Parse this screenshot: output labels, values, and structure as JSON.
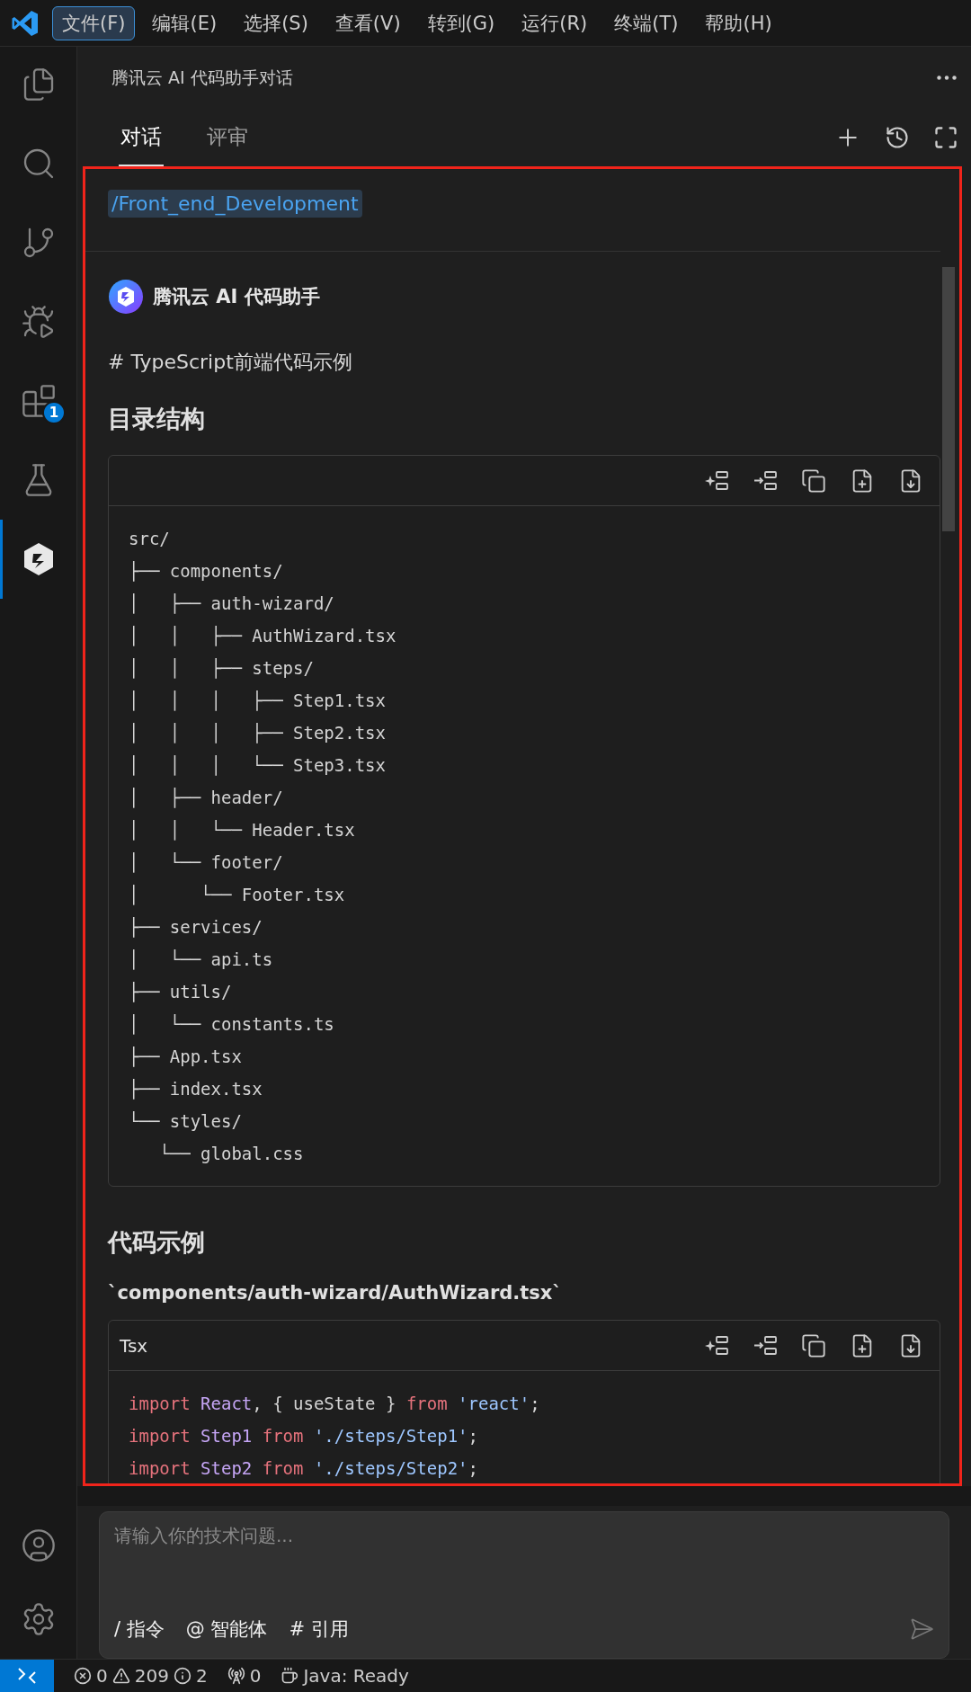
{
  "menu_bar": [
    {
      "label": "文件(F)",
      "selected": true
    },
    {
      "label": "编辑(E)",
      "selected": false
    },
    {
      "label": "选择(S)",
      "selected": false
    },
    {
      "label": "查看(V)",
      "selected": false
    },
    {
      "label": "转到(G)",
      "selected": false
    },
    {
      "label": "运行(R)",
      "selected": false
    },
    {
      "label": "终端(T)",
      "selected": false
    },
    {
      "label": "帮助(H)",
      "selected": false
    }
  ],
  "activity_bar": {
    "items": [
      {
        "kind": "explorer",
        "selected": false
      },
      {
        "kind": "search",
        "selected": false
      },
      {
        "kind": "source_control",
        "selected": false
      },
      {
        "kind": "run_debug",
        "selected": false
      },
      {
        "kind": "extensions",
        "selected": false,
        "badge": "1"
      },
      {
        "kind": "testing",
        "selected": false
      },
      {
        "kind": "assistant",
        "selected": true
      }
    ],
    "bottom_items": [
      {
        "kind": "account"
      },
      {
        "kind": "settings"
      }
    ]
  },
  "panel": {
    "title": "腾讯云 AI 代码助手对话",
    "tabs": [
      {
        "label": "对话",
        "selected": true
      },
      {
        "label": "评审",
        "selected": false
      }
    ]
  },
  "chat": {
    "annotation": {
      "kind": "frame"
    },
    "command_chip": "/Front_end_Development",
    "assistant_name": "腾讯云 AI 代码助手",
    "blocks": [
      {
        "kind": "paragraph",
        "text": "# TypeScript前端代码示例"
      },
      {
        "kind": "heading",
        "text": "目录结构"
      },
      {
        "kind": "tree",
        "lines": [
          "src/",
          "├── components/",
          "│   ├── auth-wizard/",
          "│   │   ├── AuthWizard.tsx",
          "│   │   ├── steps/",
          "│   │   │   ├── Step1.tsx",
          "│   │   │   ├── Step2.tsx",
          "│   │   │   └── Step3.tsx",
          "│   ├── header/",
          "│   │   └── Header.tsx",
          "│   └── footer/",
          "│      └── Footer.tsx",
          "├── services/",
          "│   └── api.ts",
          "├── utils/",
          "│   └── constants.ts",
          "├── App.tsx",
          "├── index.tsx",
          "└── styles/",
          "   └── global.css"
        ]
      },
      {
        "kind": "heading",
        "text": "代码示例"
      },
      {
        "kind": "path",
        "text": "`components/auth-wizard/AuthWizard.tsx`"
      },
      {
        "kind": "code",
        "language": "Tsx",
        "lines": [
          [
            {
              "kind": "keyword",
              "text": "import"
            },
            {
              "kind": "ident",
              "text": " React"
            },
            {
              "kind": "plain",
              "text": ", { useState } "
            },
            {
              "kind": "keyword",
              "text": "from"
            },
            {
              "kind": "string",
              "text": " 'react'"
            },
            {
              "kind": "plain",
              "text": ";"
            }
          ],
          [
            {
              "kind": "keyword",
              "text": "import"
            },
            {
              "kind": "ident",
              "text": " Step1 "
            },
            {
              "kind": "keyword",
              "text": "from"
            },
            {
              "kind": "string",
              "text": " './steps/Step1'"
            },
            {
              "kind": "plain",
              "text": ";"
            }
          ],
          [
            {
              "kind": "keyword",
              "text": "import"
            },
            {
              "kind": "ident",
              "text": " Step2 "
            },
            {
              "kind": "keyword",
              "text": "from"
            },
            {
              "kind": "string",
              "text": " './steps/Step2'"
            },
            {
              "kind": "plain",
              "text": ";"
            }
          ]
        ]
      }
    ]
  },
  "input": {
    "placeholder": "请输入你的技术问题...",
    "actions": [
      "/ 指令",
      "@ 智能体",
      "# 引用"
    ]
  },
  "status_bar": {
    "errors": "0",
    "warnings": "209",
    "infos": "2",
    "ports": "0",
    "java": "Java: Ready"
  }
}
